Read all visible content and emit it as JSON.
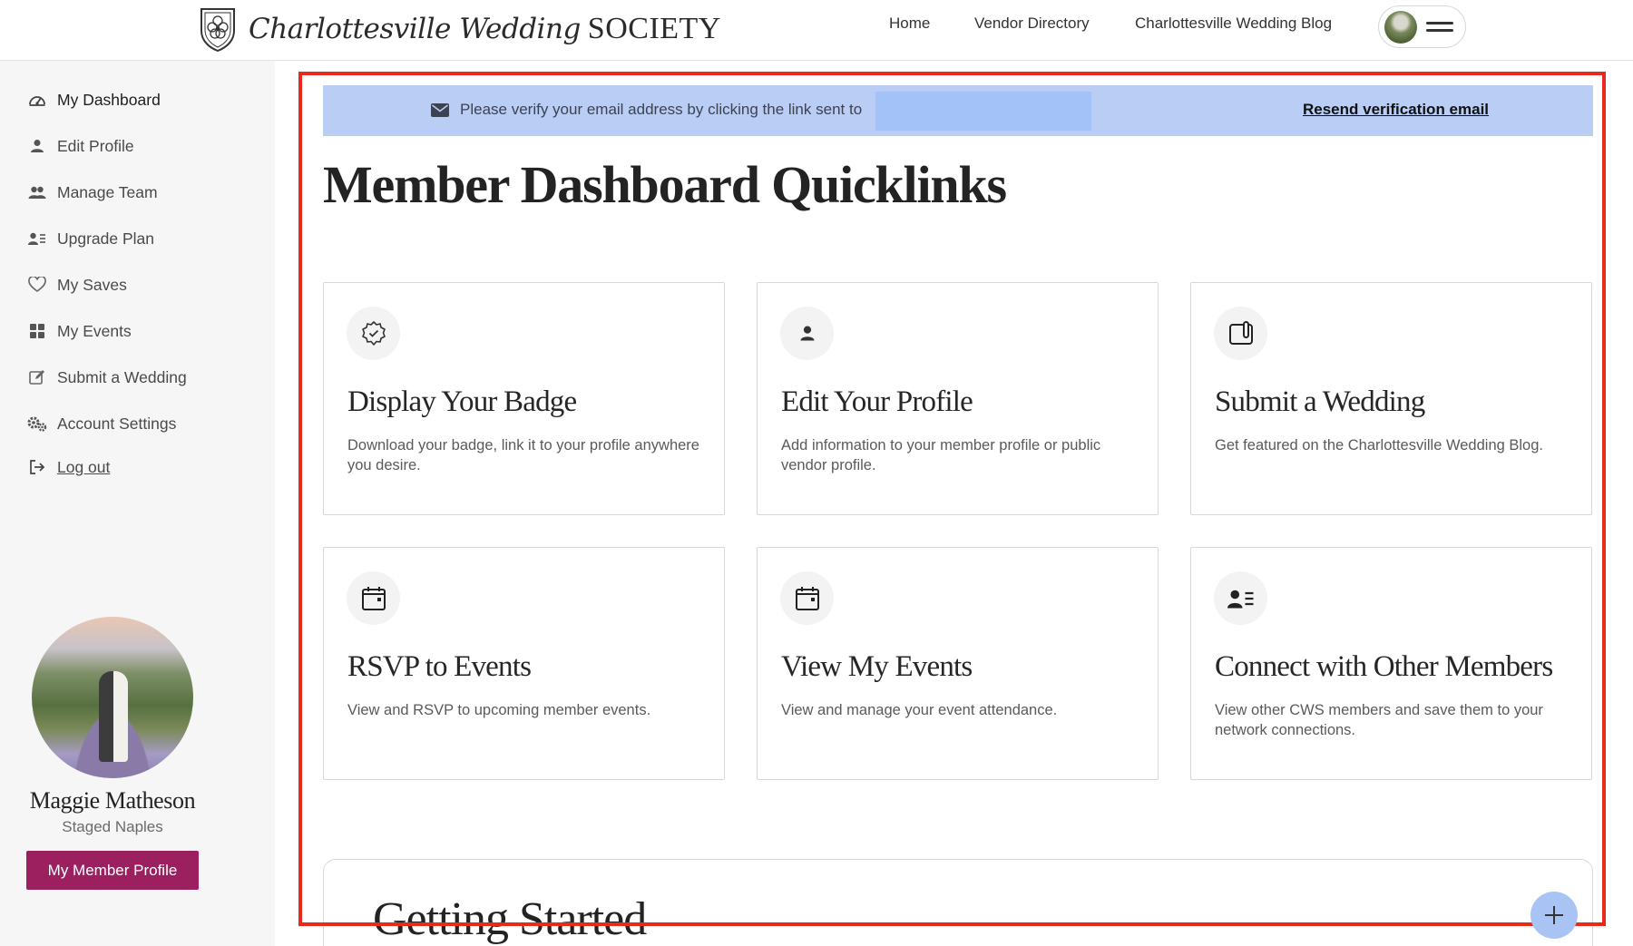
{
  "header": {
    "brand_script": "Charlottesville Wedding",
    "brand_society": "SOCIETY",
    "nav": {
      "home": "Home",
      "vendor_directory": "Vendor Directory",
      "blog": "Charlottesville Wedding Blog"
    }
  },
  "sidebar": {
    "items": [
      {
        "label": "My Dashboard",
        "icon": "dashboard-icon"
      },
      {
        "label": "Edit Profile",
        "icon": "user-icon"
      },
      {
        "label": "Manage Team",
        "icon": "team-icon"
      },
      {
        "label": "Upgrade Plan",
        "icon": "user-list-icon"
      },
      {
        "label": "My Saves",
        "icon": "heart-icon"
      },
      {
        "label": "My Events",
        "icon": "grid-icon"
      },
      {
        "label": "Submit a Wedding",
        "icon": "edit-icon"
      },
      {
        "label": "Account Settings",
        "icon": "gears-icon"
      },
      {
        "label": "Log out",
        "icon": "logout-icon"
      }
    ],
    "profile": {
      "name": "Maggie Matheson",
      "subtitle": "Staged Naples",
      "button": "My Member Profile"
    }
  },
  "verify": {
    "text": "Please verify your email address by clicking the link sent to",
    "resend": "Resend verification email"
  },
  "main": {
    "title": "Member Dashboard Quicklinks",
    "cards": [
      {
        "title": "Display Your Badge",
        "desc": "Download your badge, link it to your profile anywhere you desire.",
        "icon": "badge-check-icon"
      },
      {
        "title": "Edit Your Profile",
        "desc": "Add information to your member profile or public vendor profile.",
        "icon": "user-icon"
      },
      {
        "title": "Submit a Wedding",
        "desc": "Get featured on the Charlottesville Wedding Blog.",
        "icon": "submit-device-icon"
      },
      {
        "title": "RSVP to Events",
        "desc": "View and RSVP to upcoming member events.",
        "icon": "calendar-icon"
      },
      {
        "title": "View My Events",
        "desc": "View and manage your event attendance.",
        "icon": "calendar-icon"
      },
      {
        "title": "Connect with Other Members",
        "desc": "View other CWS members and save them to your network connections.",
        "icon": "user-list-icon"
      }
    ],
    "getting_started": "Getting Started"
  },
  "colors": {
    "accent_button": "#9c1f5f",
    "verify_bar": "#b9cdf5",
    "highlight_border": "#e8291c"
  }
}
